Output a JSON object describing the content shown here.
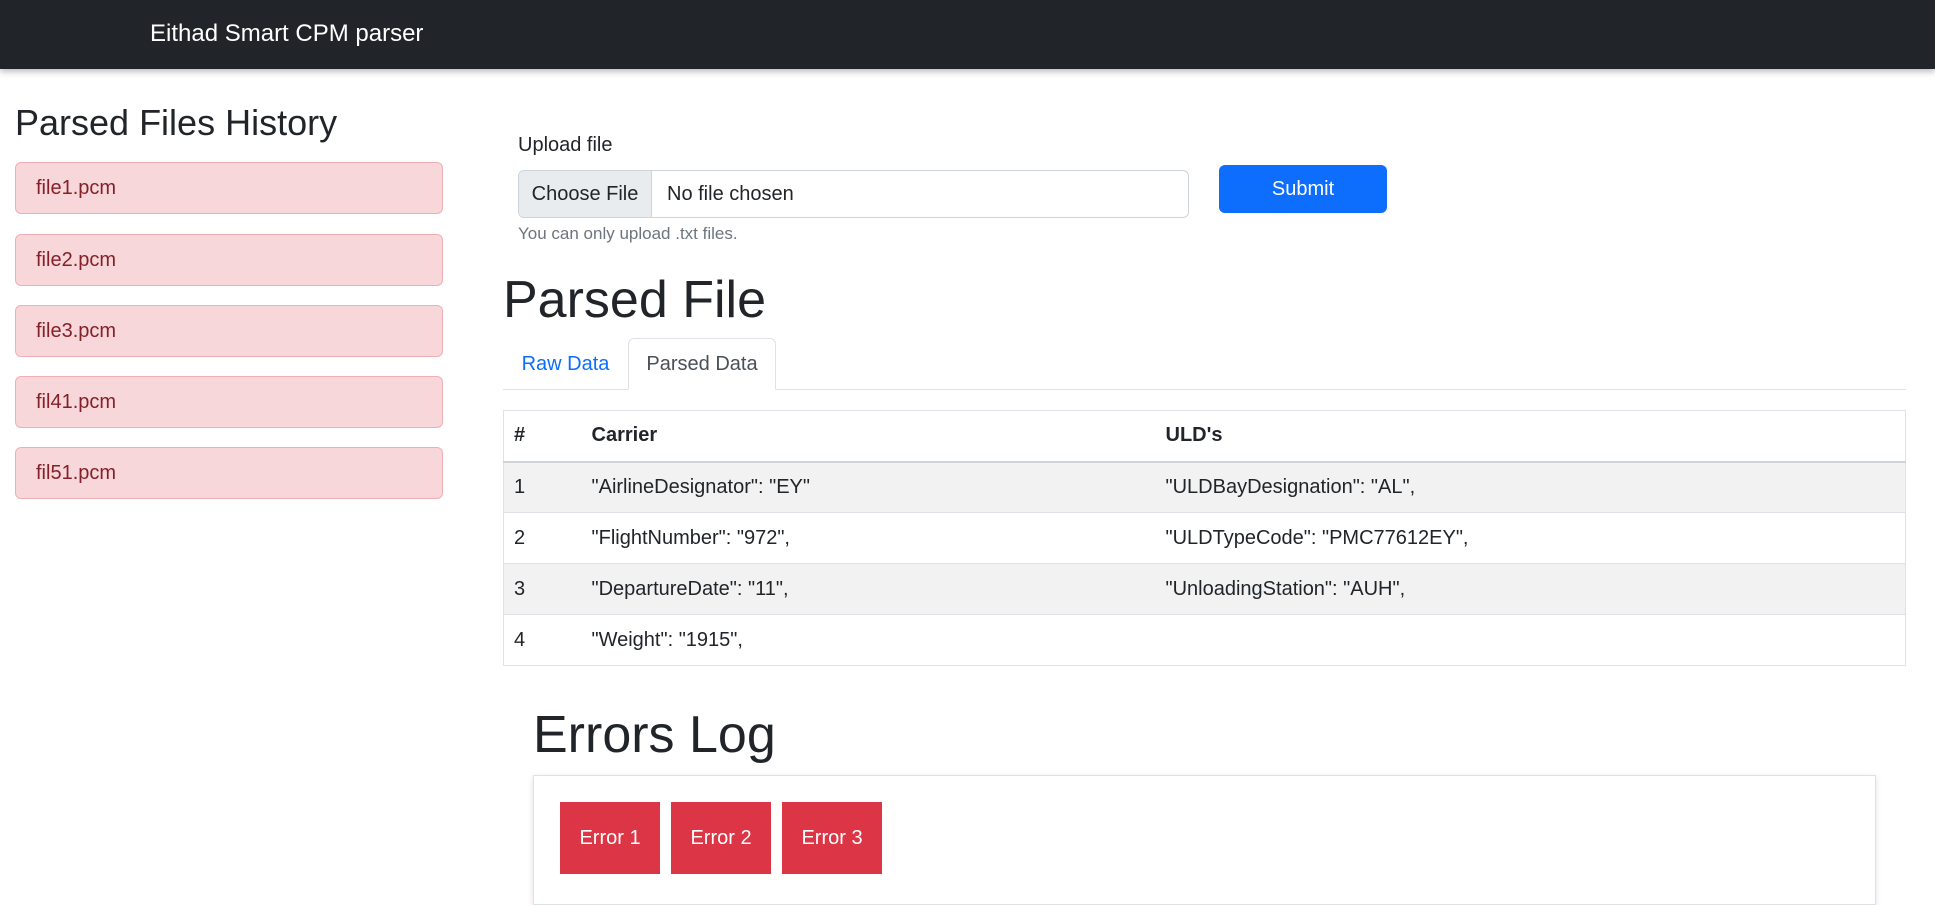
{
  "navbar": {
    "brand": "Eithad Smart CPM parser"
  },
  "sidebar": {
    "title": "Parsed Files History",
    "items": [
      {
        "label": "file1.pcm"
      },
      {
        "label": "file2.pcm"
      },
      {
        "label": "file3.pcm"
      },
      {
        "label": "fil41.pcm"
      },
      {
        "label": "fil51.pcm"
      }
    ]
  },
  "upload": {
    "label": "Upload file",
    "choose_button": "Choose File",
    "status": "No file chosen",
    "help": "You can only upload .txt files.",
    "submit": "Submit"
  },
  "parsed": {
    "title": "Parsed File",
    "tabs": [
      {
        "label": "Raw Data",
        "active": false
      },
      {
        "label": "Parsed Data",
        "active": true
      }
    ],
    "table": {
      "headers": [
        "#",
        "Carrier",
        "ULD's"
      ],
      "rows": [
        [
          "1",
          "\"AirlineDesignator\": \"EY\"",
          "\"ULDBayDesignation\": \"AL\","
        ],
        [
          "2",
          "\"FlightNumber\": \"972\",",
          "\"ULDTypeCode\": \"PMC77612EY\","
        ],
        [
          "3",
          "\"DepartureDate\": \"11\",",
          "\"UnloadingStation\": \"AUH\","
        ],
        [
          "4",
          "\"Weight\": \"1915\",",
          ""
        ]
      ]
    }
  },
  "errors": {
    "title": "Errors Log",
    "items": [
      {
        "label": "Error 1"
      },
      {
        "label": "Error 2"
      },
      {
        "label": "Error 3"
      }
    ]
  },
  "colors": {
    "navbar": "#212529",
    "primary": "#0d6efd",
    "danger": "#dc3545",
    "history_bg": "#f8d7da",
    "history_text": "#842029"
  }
}
